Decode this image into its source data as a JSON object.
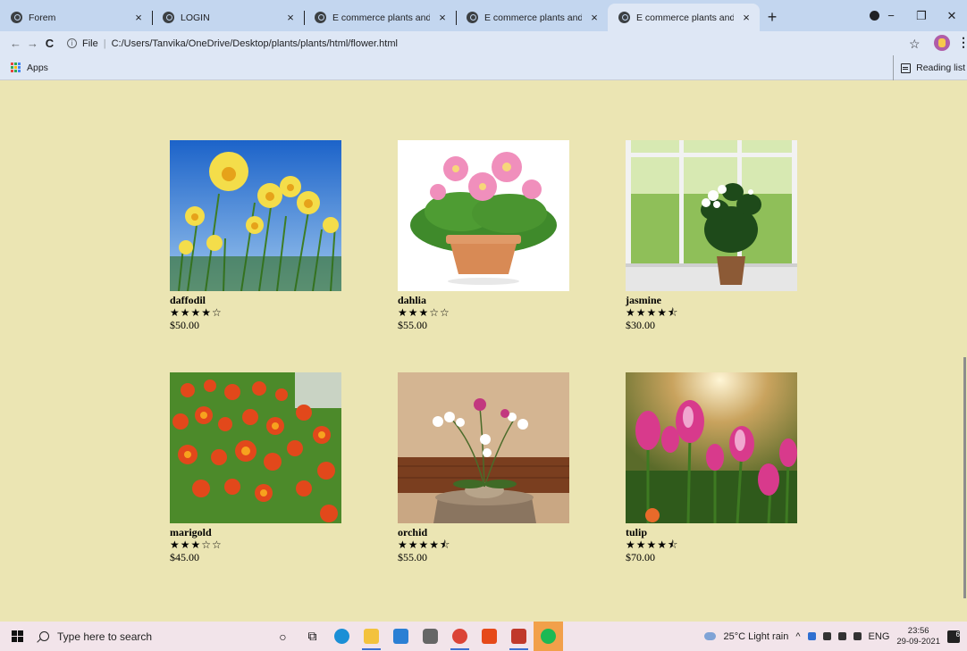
{
  "browser": {
    "tabs": [
      {
        "title": "Forem",
        "active": false
      },
      {
        "title": "LOGIN",
        "active": false
      },
      {
        "title": "E commerce plants and seeds pla",
        "active": false
      },
      {
        "title": "E commerce plants and seeds pla",
        "active": false
      },
      {
        "title": "E commerce plants and seeds pla",
        "active": true
      }
    ],
    "tab_close": "×",
    "new_tab": "+",
    "window_controls": {
      "minimize": "−",
      "maximize": "❐",
      "close": "✕"
    },
    "nav": {
      "back": "←",
      "forward": "→",
      "reload": "C"
    },
    "address": {
      "scheme": "File",
      "url": "C:/Users/Tanvika/OneDrive/Desktop/plants/plants/html/flower.html"
    },
    "bookmark_star": "☆",
    "menu": "⋮",
    "bookmarks": {
      "apps": "Apps",
      "reading_list": "Reading list"
    }
  },
  "products": [
    {
      "name": "daffodil",
      "stars": "★★★★☆",
      "price": "$50.00",
      "image": "daffodil-photo"
    },
    {
      "name": "dahlia",
      "stars": "★★★☆☆",
      "price": "$55.00",
      "image": "dahlia-photo"
    },
    {
      "name": "jasmine",
      "stars": "★★★★⯪",
      "price": "$30.00",
      "image": "jasmine-photo"
    },
    {
      "name": "marigold",
      "stars": "★★★☆☆",
      "price": "$45.00",
      "image": "marigold-photo"
    },
    {
      "name": "orchid",
      "stars": "★★★★⯪",
      "price": "$55.00",
      "image": "orchid-photo"
    },
    {
      "name": "tulip",
      "stars": "★★★★⯪",
      "price": "$70.00",
      "image": "tulip-photo"
    }
  ],
  "taskbar": {
    "search_placeholder": "Type here to search",
    "weather": "25°C  Light rain",
    "tray_caret": "^",
    "language": "ENG",
    "time": "23:56",
    "date": "29-09-2021",
    "notification_count": "6"
  },
  "colors": {
    "page_bg": "#ebe5b3",
    "tab_strip": "#c3d6ef",
    "toolbar": "#dee7f5"
  }
}
